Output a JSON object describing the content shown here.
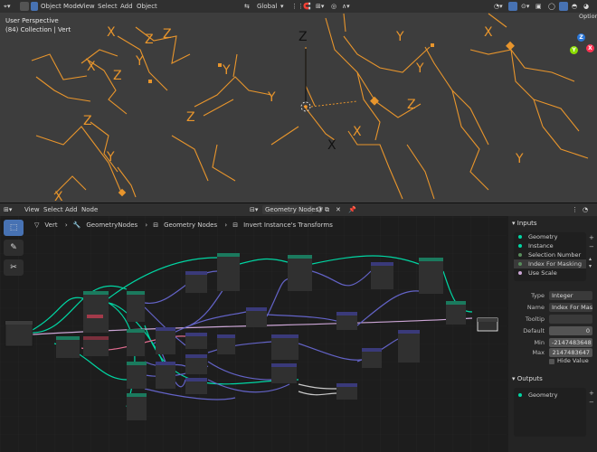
{
  "viewport": {
    "header": {
      "mode_label": "Object Mode",
      "menus": [
        "View",
        "Select",
        "Add",
        "Object"
      ],
      "transform_orientation": "Global",
      "options_label": "Options"
    },
    "info": {
      "line1": "User Perspective",
      "line2": "(84) Collection | Vert"
    },
    "gizmo": {
      "z": "Z",
      "y": "Y",
      "x": "X"
    }
  },
  "node_editor": {
    "header": {
      "menus": [
        "View",
        "Select",
        "Add",
        "Node"
      ],
      "tree_name": "Geometry Nodes"
    },
    "breadcrumb": [
      "Vert",
      "GeometryNodes",
      "Geometry Nodes",
      "Invert Instance's Transforms"
    ]
  },
  "sidepanel": {
    "inputs_title": "Inputs",
    "inputs": [
      {
        "label": "Geometry",
        "color": "#00d6a3"
      },
      {
        "label": "Instance",
        "color": "#00d6a3"
      },
      {
        "label": "Selection Number",
        "color": "#598c5c"
      },
      {
        "label": "Index For Masking",
        "color": "#598c5c"
      },
      {
        "label": "Use Scale",
        "color": "#cca6d6"
      }
    ],
    "selected_input": 3,
    "props": {
      "type_label": "Type",
      "type_value": "Integer",
      "name_label": "Name",
      "name_value": "Index For Mask...",
      "tooltip_label": "Tooltip",
      "tooltip_value": "",
      "default_label": "Default",
      "default_value": "0",
      "min_label": "Min",
      "min_value": "-2147483648",
      "max_label": "Max",
      "max_value": "2147483647",
      "hide_value_label": "Hide Value"
    },
    "outputs_title": "Outputs",
    "outputs": [
      {
        "label": "Geometry",
        "color": "#00d6a3"
      }
    ]
  },
  "colors": {
    "object_orange": "#e8952c",
    "geometry_link": "#00d6a3",
    "vector_link": "#6363c7",
    "bool_link": "#cca6d6",
    "accent": "#4772b3"
  }
}
